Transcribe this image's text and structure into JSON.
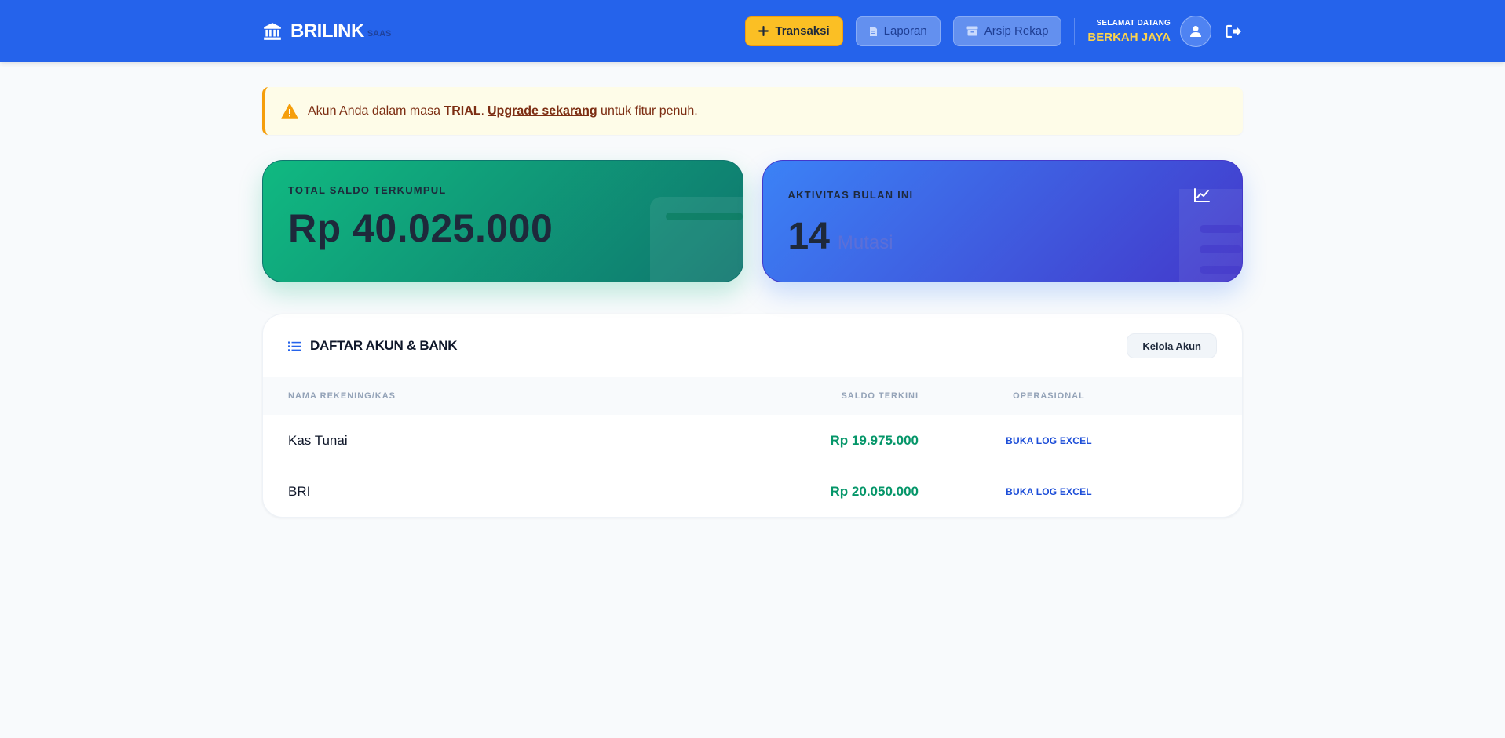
{
  "header": {
    "brand": "BRILINK",
    "brand_sub": "SAAS",
    "buttons": {
      "transaksi": "Transaksi",
      "laporan": "Laporan",
      "arsip": "Arsip Rekap"
    },
    "welcome_label": "SELAMAT DATANG",
    "user_name": "BERKAH JAYA"
  },
  "alert": {
    "prefix": "Akun Anda dalam masa ",
    "status": "TRIAL",
    "dot": ".",
    "link": "Upgrade sekarang",
    "suffix": " untuk fitur penuh."
  },
  "cards": {
    "saldo": {
      "label": "TOTAL SALDO TERKUMPUL",
      "value": "Rp 40.025.000"
    },
    "aktivitas": {
      "label": "AKTIVITAS BULAN INI",
      "count": "14",
      "unit": "Mutasi"
    }
  },
  "accounts": {
    "title": "DAFTAR AKUN & BANK",
    "manage_label": "Kelola Akun",
    "columns": [
      "NAMA REKENING/KAS",
      "SALDO TERKINI",
      "OPERASIONAL"
    ],
    "rows": [
      {
        "name": "Kas Tunai",
        "balance": "Rp 19.975.000",
        "action": "BUKA LOG EXCEL"
      },
      {
        "name": "BRI",
        "balance": "Rp 20.050.000",
        "action": "BUKA LOG EXCEL"
      }
    ]
  },
  "colors": {
    "primary": "#2563eb",
    "accent": "#fbbf24",
    "success": "#059669",
    "warning": "#f59e0b"
  }
}
